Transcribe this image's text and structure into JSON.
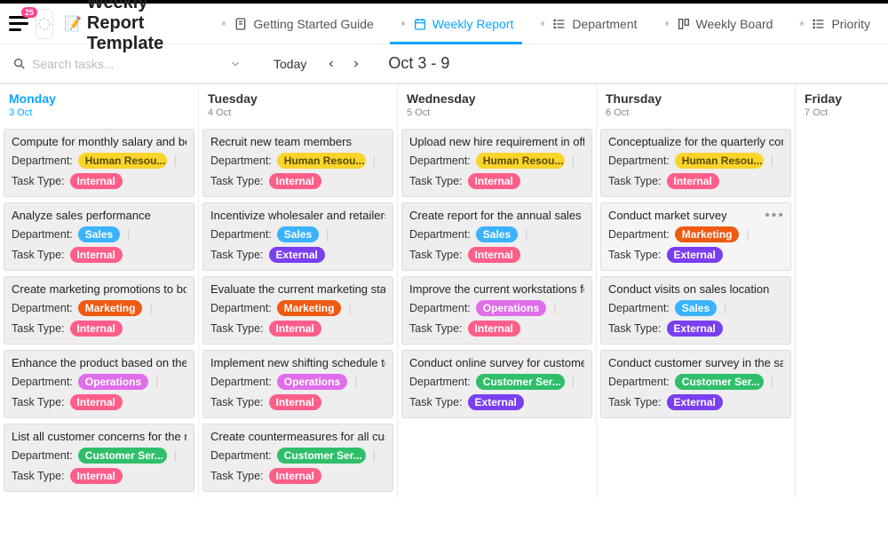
{
  "badge_count": "25",
  "page_title": "Weekly Report Template",
  "title_emoji": "📝",
  "search_placeholder": "Search tasks...",
  "today_label": "Today",
  "date_range": "Oct 3 - 9",
  "tabs": [
    {
      "label": "Getting Started Guide",
      "icon": "doc-icon"
    },
    {
      "label": "Weekly Report",
      "icon": "calendar-icon",
      "active": true
    },
    {
      "label": "Department",
      "icon": "list-icon"
    },
    {
      "label": "Weekly Board",
      "icon": "board-icon"
    },
    {
      "label": "Priority",
      "icon": "list-icon"
    }
  ],
  "field_labels": {
    "department": "Department:",
    "task_type": "Task Type:"
  },
  "chip_colors": {
    "Human Resou...": "#f9d52c",
    "Sales": "#3ab3ff",
    "Marketing": "#ef5a13",
    "Operations": "#e06eea",
    "Customer Ser...": "#2fbf6b",
    "Internal": "#ff5e8a",
    "External": "#7a3ff0"
  },
  "days": [
    {
      "name": "Monday",
      "date": "3 Oct",
      "active": true,
      "cards": [
        {
          "title": "Compute for monthly salary and be",
          "dept": "Human Resou...",
          "type": "Internal"
        },
        {
          "title": "Analyze sales performance",
          "dept": "Sales",
          "type": "Internal"
        },
        {
          "title": "Create marketing promotions to bo",
          "dept": "Marketing",
          "type": "Internal"
        },
        {
          "title": "Enhance the product based on the l",
          "dept": "Operations",
          "type": "Internal"
        },
        {
          "title": "List all customer concerns for the m",
          "dept": "Customer Ser...",
          "type": "Internal"
        }
      ]
    },
    {
      "name": "Tuesday",
      "date": "4 Oct",
      "cards": [
        {
          "title": "Recruit new team members",
          "dept": "Human Resou...",
          "type": "Internal"
        },
        {
          "title": "Incentivize wholesaler and retailers t",
          "dept": "Sales",
          "type": "External"
        },
        {
          "title": "Evaluate the current marketing statu",
          "dept": "Marketing",
          "type": "Internal"
        },
        {
          "title": "Implement new shifting schedule to",
          "dept": "Operations",
          "type": "Internal"
        },
        {
          "title": "Create countermeasures for all custo",
          "dept": "Customer Ser...",
          "type": "Internal"
        }
      ]
    },
    {
      "name": "Wednesday",
      "date": "5 Oct",
      "cards": [
        {
          "title": "Upload new hire requirement in offi",
          "dept": "Human Resou...",
          "type": "Internal"
        },
        {
          "title": "Create report for the annual sales",
          "dept": "Sales",
          "type": "Internal"
        },
        {
          "title": "Improve the current workstations fo",
          "dept": "Operations",
          "type": "Internal"
        },
        {
          "title": "Conduct online survey for customer",
          "dept": "Customer Ser...",
          "type": "External"
        }
      ]
    },
    {
      "name": "Thursday",
      "date": "6 Oct",
      "cards": [
        {
          "title": "Conceptualize for the quarterly com",
          "dept": "Human Resou...",
          "type": "Internal"
        },
        {
          "title": "Conduct market survey",
          "dept": "Marketing",
          "type": "External",
          "hover": true
        },
        {
          "title": "Conduct visits on sales location",
          "dept": "Sales",
          "type": "External"
        },
        {
          "title": "Conduct customer survey in the sale",
          "dept": "Customer Ser...",
          "type": "External"
        }
      ]
    },
    {
      "name": "Friday",
      "date": "7 Oct",
      "cards": []
    }
  ]
}
